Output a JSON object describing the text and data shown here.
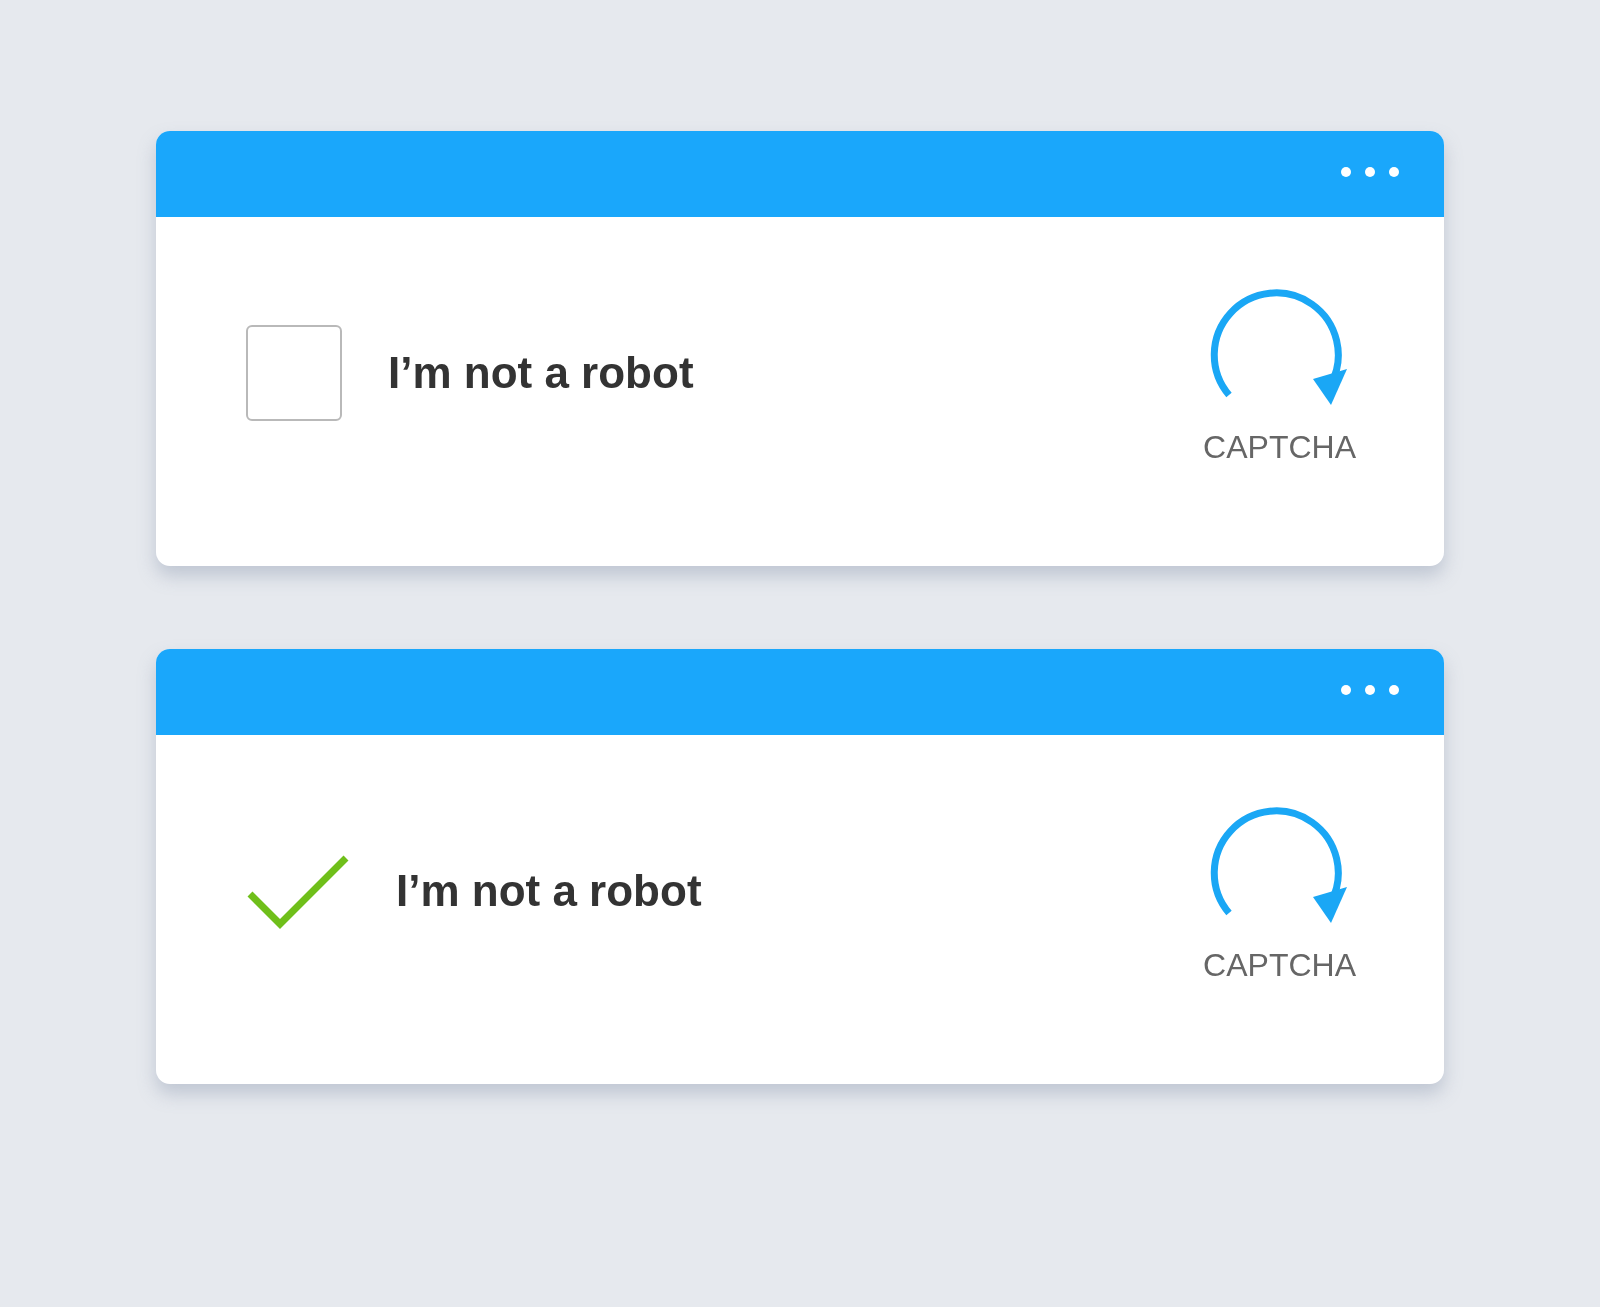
{
  "widgets": [
    {
      "checked": false,
      "label": "I’m not a robot",
      "brand": "CAPTCHA"
    },
    {
      "checked": true,
      "label": "I’m not a robot",
      "brand": "CAPTCHA"
    }
  ]
}
